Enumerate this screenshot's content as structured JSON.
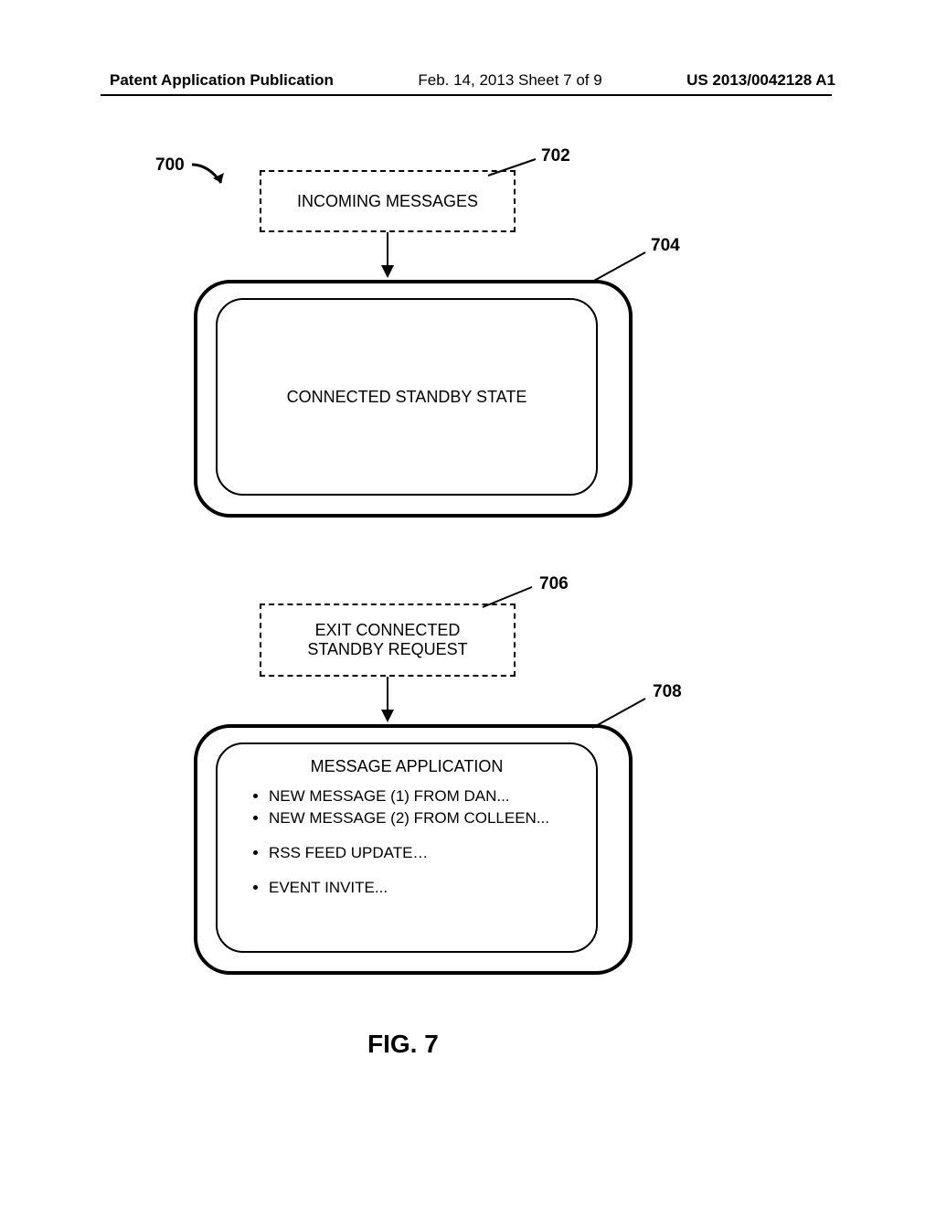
{
  "header": {
    "left": "Patent Application Publication",
    "center": "Feb. 14, 2013  Sheet 7 of 9",
    "right": "US 2013/0042128 A1"
  },
  "labels": {
    "n700": "700",
    "n702": "702",
    "n704": "704",
    "n706": "706",
    "n708": "708"
  },
  "boxes": {
    "incoming": "INCOMING MESSAGES",
    "connected": "CONNECTED STANDBY STATE",
    "exit_l1": "EXIT CONNECTED",
    "exit_l2": "STANDBY REQUEST",
    "app_title": "MESSAGE APPLICATION"
  },
  "messages": {
    "m1": "NEW MESSAGE (1) FROM DAN...",
    "m2": "NEW MESSAGE (2) FROM COLLEEN...",
    "m3": "RSS FEED UPDATE…",
    "m4": "EVENT INVITE..."
  },
  "caption": "FIG. 7"
}
